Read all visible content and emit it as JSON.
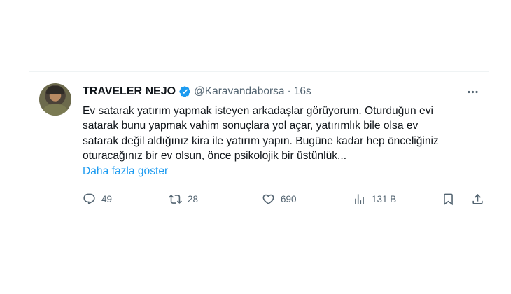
{
  "tweet": {
    "author_name": "TRAVELER NEJO",
    "handle": "@Karavandaborsa",
    "separator": "·",
    "time": "16s",
    "text_lines": [
      "Ev satarak yatırım yapmak isteyen arkadaşlar görüyorum. Oturduğun evi",
      "satarak bunu yapmak vahim sonuçlara yol açar, yatırımlık bile olsa ev",
      "satarak değil aldığınız kira ile yatırım yapın. Bugüne kadar hep önceliğiniz",
      "oturacağınız bir ev olsun, önce psikolojik bir üstünlük..."
    ],
    "show_more": "Daha fazla göster"
  },
  "actions": {
    "replies": "49",
    "retweets": "28",
    "likes": "690",
    "views": "131 B"
  },
  "icons": {
    "verified": "verified-badge-icon",
    "more": "more-icon",
    "reply": "reply-icon",
    "retweet": "retweet-icon",
    "like": "heart-icon",
    "views": "views-icon",
    "bookmark": "bookmark-icon",
    "share": "share-icon"
  },
  "colors": {
    "accent": "#1d9bf0",
    "text": "#0f1419",
    "secondary": "#536471",
    "divider": "#eff3f4"
  }
}
